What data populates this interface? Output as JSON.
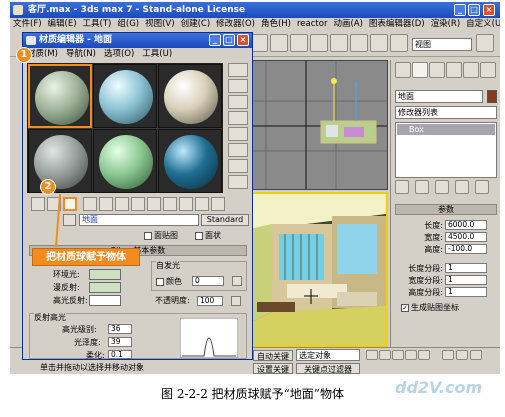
{
  "app": {
    "title": "客厅.max - 3ds max 7 - Stand-alone License"
  },
  "menubar": [
    "文件(F)",
    "编辑(E)",
    "工具(T)",
    "组(G)",
    "视图(V)",
    "创建(C)",
    "修改器(O)",
    "角色(H)",
    "reactor",
    "动画(A)",
    "图表编辑器(D)",
    "渲染(R)",
    "自定义(U)"
  ],
  "toolbar": {
    "view_select": "视图"
  },
  "command_panel": {
    "object_name": "地面",
    "modifier_list": "修改器列表",
    "stack_item": "Box",
    "params_title": "参数",
    "params": [
      {
        "label": "长度:",
        "value": "6000.0"
      },
      {
        "label": "宽度:",
        "value": "4500.0"
      },
      {
        "label": "高度:",
        "value": "-100.0"
      },
      {
        "label": "长度分段:",
        "value": "1"
      },
      {
        "label": "宽度分段:",
        "value": "1"
      },
      {
        "label": "高度分段:",
        "value": "1"
      }
    ],
    "gen_mapping": "生成贴图坐标"
  },
  "material_editor": {
    "title": "材质编辑器 - 地面",
    "menu": [
      "材质(M)",
      "导航(N)",
      "选项(O)",
      "工具(U)"
    ],
    "material_name": "地面",
    "type_button": "Standard",
    "wire_label": "面贴图",
    "faceted_label": "面状",
    "blinn_header": "Blinn 基本参数",
    "self_illum_label": "自发光",
    "color_label": "颜色",
    "color_value": "0",
    "ambient_label": "环境光:",
    "diffuse_label": "漫反射:",
    "specular_label": "高光反射:",
    "opacity_label": "不透明度:",
    "opacity_value": "100",
    "spec_highlights": "反射高光",
    "spec_level_label": "高光级别:",
    "spec_level_value": "36",
    "gloss_label": "光泽度:",
    "gloss_value": "39",
    "soften_label": "柔化:",
    "soften_value": "0.1",
    "sphere_colors": [
      "#9fb49a",
      "#8cc4d4",
      "#d8d0b8",
      "#9aa2a0",
      "#8cc894",
      "#1f6f92"
    ]
  },
  "annotations": {
    "badge_1": "1",
    "badge_2": "2",
    "callout": "把材质球赋予物体"
  },
  "statusbar": {
    "auto_key": "自动关键点",
    "selected": "选定对象",
    "set_key": "设置关键点",
    "key_filters": "关键点过滤器",
    "hint": "单击并拖动以选择并移动对象"
  },
  "caption": "图 2-2-2  把材质球赋予“地面”物体",
  "watermark": "dd2V.com"
}
